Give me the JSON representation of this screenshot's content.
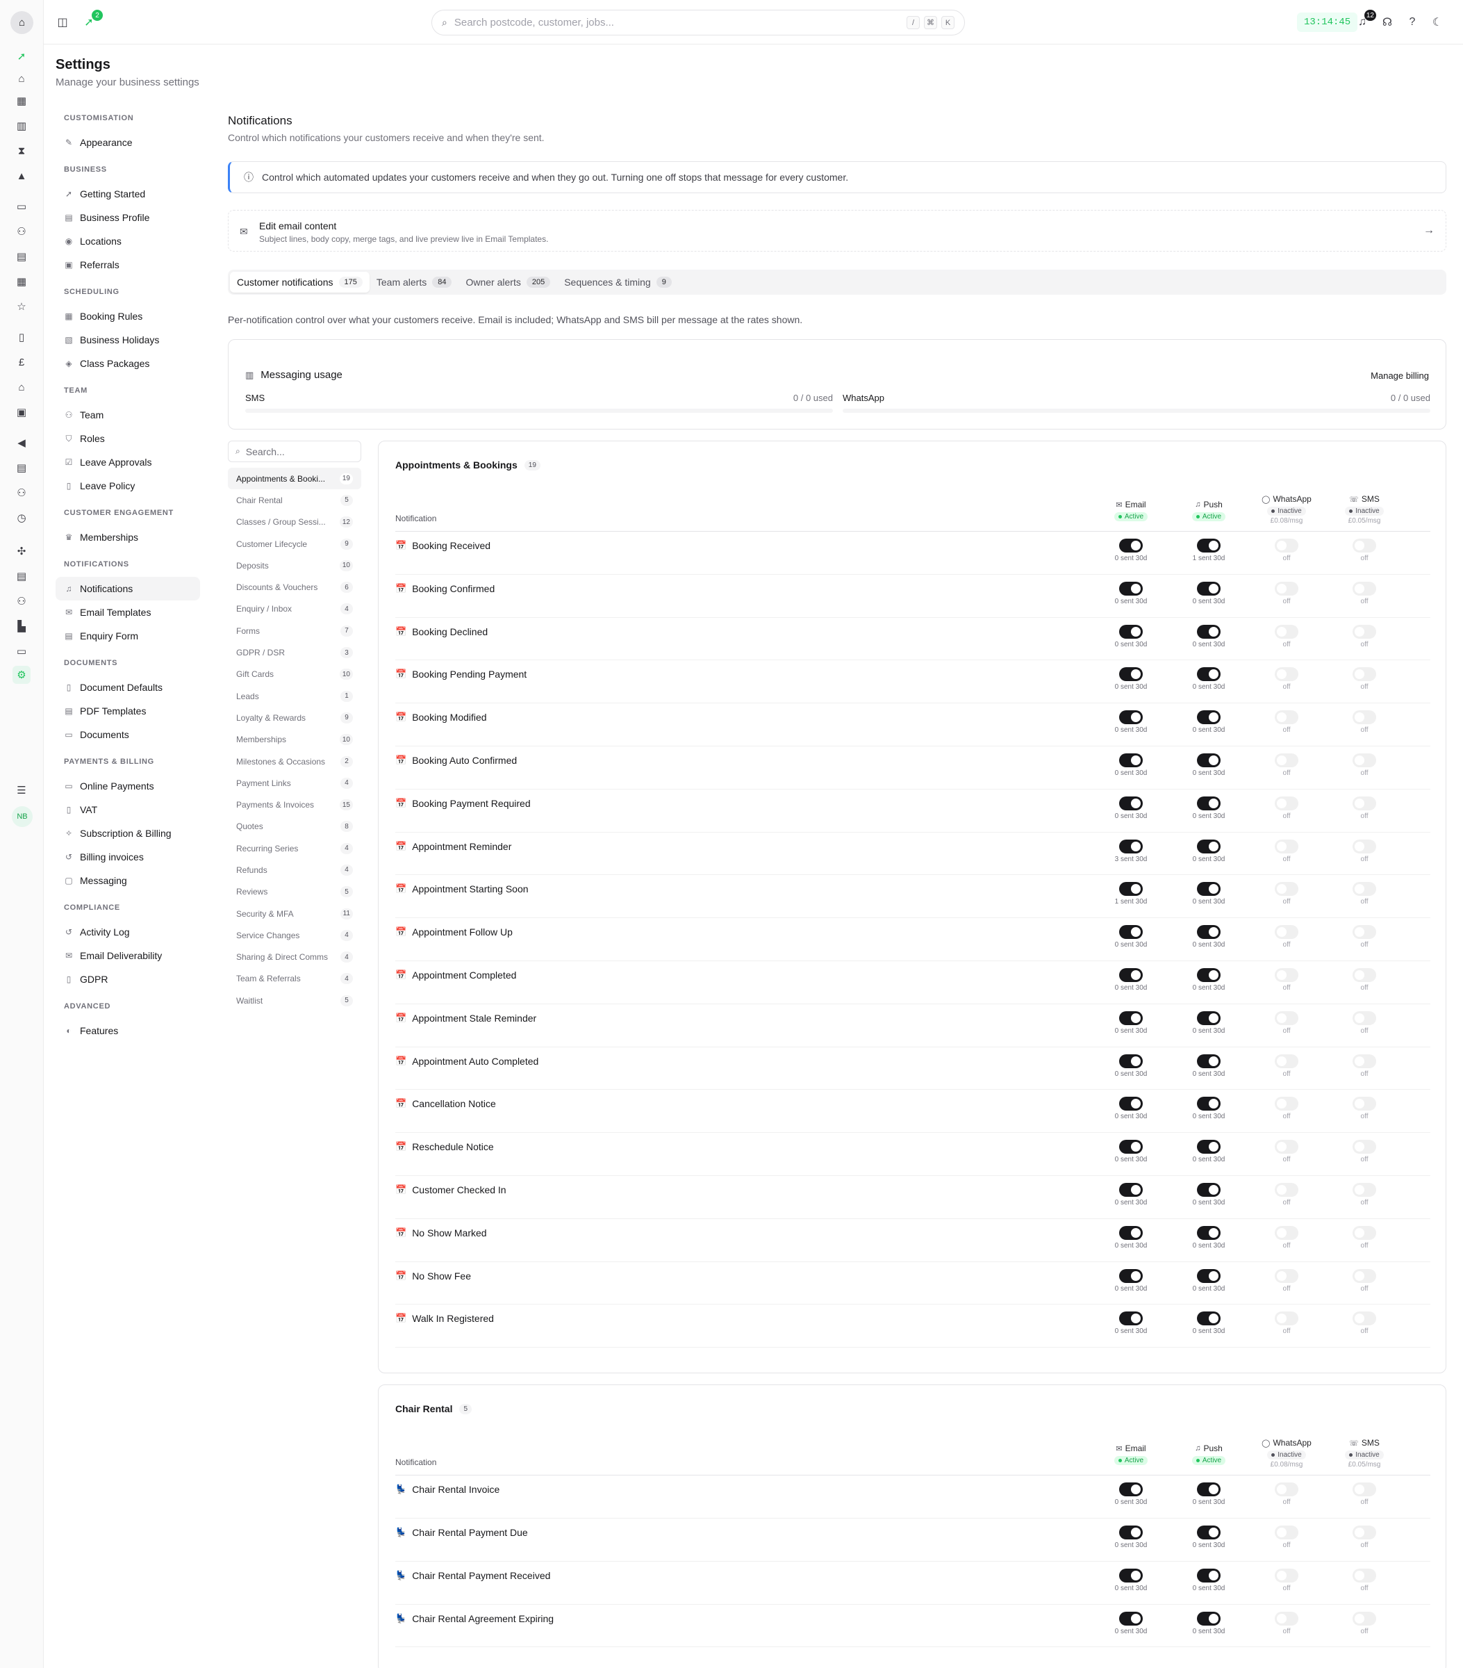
{
  "topbar": {
    "rocket_badge": "2",
    "search_placeholder": "Search postcode, customer, jobs...",
    "kbd": [
      "/",
      "⌘",
      "K"
    ],
    "clock": "13:14:45",
    "notif_count": "12"
  },
  "rail": {
    "avatar": "NB"
  },
  "page": {
    "title": "Settings",
    "subtitle": "Manage your business settings"
  },
  "nav": [
    {
      "section": "CUSTOMISATION",
      "items": [
        {
          "label": "Appearance",
          "icon": "brush-icon"
        }
      ]
    },
    {
      "section": "BUSINESS",
      "items": [
        {
          "label": "Getting Started",
          "icon": "rocket-icon"
        },
        {
          "label": "Business Profile",
          "icon": "building-icon"
        },
        {
          "label": "Locations",
          "icon": "pin-icon"
        },
        {
          "label": "Referrals",
          "icon": "gift-icon"
        }
      ]
    },
    {
      "section": "SCHEDULING",
      "items": [
        {
          "label": "Booking Rules",
          "icon": "calendar-icon"
        },
        {
          "label": "Business Holidays",
          "icon": "calendar-off-icon"
        },
        {
          "label": "Class Packages",
          "icon": "package-icon"
        }
      ]
    },
    {
      "section": "TEAM",
      "items": [
        {
          "label": "Team",
          "icon": "users-icon"
        },
        {
          "label": "Roles",
          "icon": "shield-icon"
        },
        {
          "label": "Leave Approvals",
          "icon": "check-square-icon"
        },
        {
          "label": "Leave Policy",
          "icon": "document-icon"
        }
      ]
    },
    {
      "section": "CUSTOMER ENGAGEMENT",
      "items": [
        {
          "label": "Memberships",
          "icon": "crown-icon"
        }
      ]
    },
    {
      "section": "NOTIFICATIONS",
      "items": [
        {
          "label": "Notifications",
          "icon": "bell-icon",
          "active": true
        },
        {
          "label": "Email Templates",
          "icon": "mail-icon"
        },
        {
          "label": "Enquiry Form",
          "icon": "form-icon"
        }
      ]
    },
    {
      "section": "DOCUMENTS",
      "items": [
        {
          "label": "Document Defaults",
          "icon": "file-icon"
        },
        {
          "label": "PDF Templates",
          "icon": "file-text-icon"
        },
        {
          "label": "Documents",
          "icon": "folder-icon"
        }
      ]
    },
    {
      "section": "PAYMENTS & BILLING",
      "items": [
        {
          "label": "Online Payments",
          "icon": "card-icon"
        },
        {
          "label": "VAT",
          "icon": "receipt-icon"
        },
        {
          "label": "Subscription & Billing",
          "icon": "sparkle-icon"
        },
        {
          "label": "Billing invoices",
          "icon": "history-icon"
        },
        {
          "label": "Messaging",
          "icon": "chat-icon"
        }
      ]
    },
    {
      "section": "COMPLIANCE",
      "items": [
        {
          "label": "Activity Log",
          "icon": "history-icon"
        },
        {
          "label": "Email Deliverability",
          "icon": "mail-icon"
        },
        {
          "label": "GDPR",
          "icon": "file-icon"
        }
      ]
    },
    {
      "section": "ADVANCED",
      "items": [
        {
          "label": "Features",
          "icon": "toggle-icon"
        }
      ]
    }
  ],
  "main": {
    "title": "Notifications",
    "subtitle": "Control which notifications your customers receive and when they're sent.",
    "info": "Control which automated updates your customers receive and when they go out. Turning one off stops that message for every customer.",
    "email_box": {
      "title": "Edit email content",
      "subtitle": "Subject lines, body copy, merge tags, and live preview live in Email Templates."
    },
    "tabs": [
      {
        "label": "Customer notifications",
        "count": "175",
        "active": true
      },
      {
        "label": "Team alerts",
        "count": "84"
      },
      {
        "label": "Owner alerts",
        "count": "205"
      },
      {
        "label": "Sequences & timing",
        "count": "9"
      }
    ],
    "description": "Per-notification control over what your customers receive. Email is included; WhatsApp and SMS bill per message at the rates shown.",
    "usage": {
      "title": "Messaging usage",
      "manage": "Manage billing",
      "sms": {
        "label": "SMS",
        "value": "0 / 0 used"
      },
      "whatsapp": {
        "label": "WhatsApp",
        "value": "0 / 0 used"
      }
    },
    "cat_search_placeholder": "Search...",
    "categories": [
      {
        "name": "Appointments & Booki...",
        "count": "19",
        "active": true
      },
      {
        "name": "Chair Rental",
        "count": "5"
      },
      {
        "name": "Classes / Group Sessi...",
        "count": "12"
      },
      {
        "name": "Customer Lifecycle",
        "count": "9"
      },
      {
        "name": "Deposits",
        "count": "10"
      },
      {
        "name": "Discounts & Vouchers",
        "count": "6"
      },
      {
        "name": "Enquiry / Inbox",
        "count": "4"
      },
      {
        "name": "Forms",
        "count": "7"
      },
      {
        "name": "GDPR / DSR",
        "count": "3"
      },
      {
        "name": "Gift Cards",
        "count": "10"
      },
      {
        "name": "Leads",
        "count": "1"
      },
      {
        "name": "Loyalty & Rewards",
        "count": "9"
      },
      {
        "name": "Memberships",
        "count": "10"
      },
      {
        "name": "Milestones & Occasions",
        "count": "2"
      },
      {
        "name": "Payment Links",
        "count": "4"
      },
      {
        "name": "Payments & Invoices",
        "count": "15"
      },
      {
        "name": "Quotes",
        "count": "8"
      },
      {
        "name": "Recurring Series",
        "count": "4"
      },
      {
        "name": "Refunds",
        "count": "4"
      },
      {
        "name": "Reviews",
        "count": "5"
      },
      {
        "name": "Security & MFA",
        "count": "11"
      },
      {
        "name": "Service Changes",
        "count": "4"
      },
      {
        "name": "Sharing & Direct Comms",
        "count": "4"
      },
      {
        "name": "Team & Referrals",
        "count": "4"
      },
      {
        "name": "Waitlist",
        "count": "5"
      }
    ],
    "columns": {
      "notification": "Notification",
      "email": {
        "label": "Email",
        "status": "Active"
      },
      "push": {
        "label": "Push",
        "status": "Active"
      },
      "whatsapp": {
        "label": "WhatsApp",
        "status": "Inactive",
        "price": "£0.08/msg"
      },
      "sms": {
        "label": "SMS",
        "status": "Inactive",
        "price": "£0.05/msg"
      }
    },
    "off_label": "off",
    "groups": [
      {
        "title": "Appointments & Bookings",
        "count": "19",
        "icon": "calendar-emoji-icon",
        "rows": [
          {
            "name": "Booking Received",
            "email": "0 sent 30d",
            "push": "1 sent 30d"
          },
          {
            "name": "Booking Confirmed",
            "email": "0 sent 30d",
            "push": "0 sent 30d"
          },
          {
            "name": "Booking Declined",
            "email": "0 sent 30d",
            "push": "0 sent 30d"
          },
          {
            "name": "Booking Pending Payment",
            "email": "0 sent 30d",
            "push": "0 sent 30d"
          },
          {
            "name": "Booking Modified",
            "email": "0 sent 30d",
            "push": "0 sent 30d"
          },
          {
            "name": "Booking Auto Confirmed",
            "email": "0 sent 30d",
            "push": "0 sent 30d"
          },
          {
            "name": "Booking Payment Required",
            "email": "0 sent 30d",
            "push": "0 sent 30d"
          },
          {
            "name": "Appointment Reminder",
            "email": "3 sent 30d",
            "push": "0 sent 30d"
          },
          {
            "name": "Appointment Starting Soon",
            "email": "1 sent 30d",
            "push": "0 sent 30d"
          },
          {
            "name": "Appointment Follow Up",
            "email": "0 sent 30d",
            "push": "0 sent 30d"
          },
          {
            "name": "Appointment Completed",
            "email": "0 sent 30d",
            "push": "0 sent 30d"
          },
          {
            "name": "Appointment Stale Reminder",
            "email": "0 sent 30d",
            "push": "0 sent 30d"
          },
          {
            "name": "Appointment Auto Completed",
            "email": "0 sent 30d",
            "push": "0 sent 30d"
          },
          {
            "name": "Cancellation Notice",
            "email": "0 sent 30d",
            "push": "0 sent 30d"
          },
          {
            "name": "Reschedule Notice",
            "email": "0 sent 30d",
            "push": "0 sent 30d"
          },
          {
            "name": "Customer Checked In",
            "email": "0 sent 30d",
            "push": "0 sent 30d"
          },
          {
            "name": "No Show Marked",
            "email": "0 sent 30d",
            "push": "0 sent 30d"
          },
          {
            "name": "No Show Fee",
            "email": "0 sent 30d",
            "push": "0 sent 30d"
          },
          {
            "name": "Walk In Registered",
            "email": "0 sent 30d",
            "push": "0 sent 30d"
          }
        ]
      },
      {
        "title": "Chair Rental",
        "count": "5",
        "icon": "chair-emoji-icon",
        "rows": [
          {
            "name": "Chair Rental Invoice",
            "email": "0 sent 30d",
            "push": "0 sent 30d"
          },
          {
            "name": "Chair Rental Payment Due",
            "email": "0 sent 30d",
            "push": "0 sent 30d"
          },
          {
            "name": "Chair Rental Payment Received",
            "email": "0 sent 30d",
            "push": "0 sent 30d"
          },
          {
            "name": "Chair Rental Agreement Expiring",
            "email": "0 sent 30d",
            "push": "0 sent 30d"
          }
        ]
      }
    ]
  }
}
